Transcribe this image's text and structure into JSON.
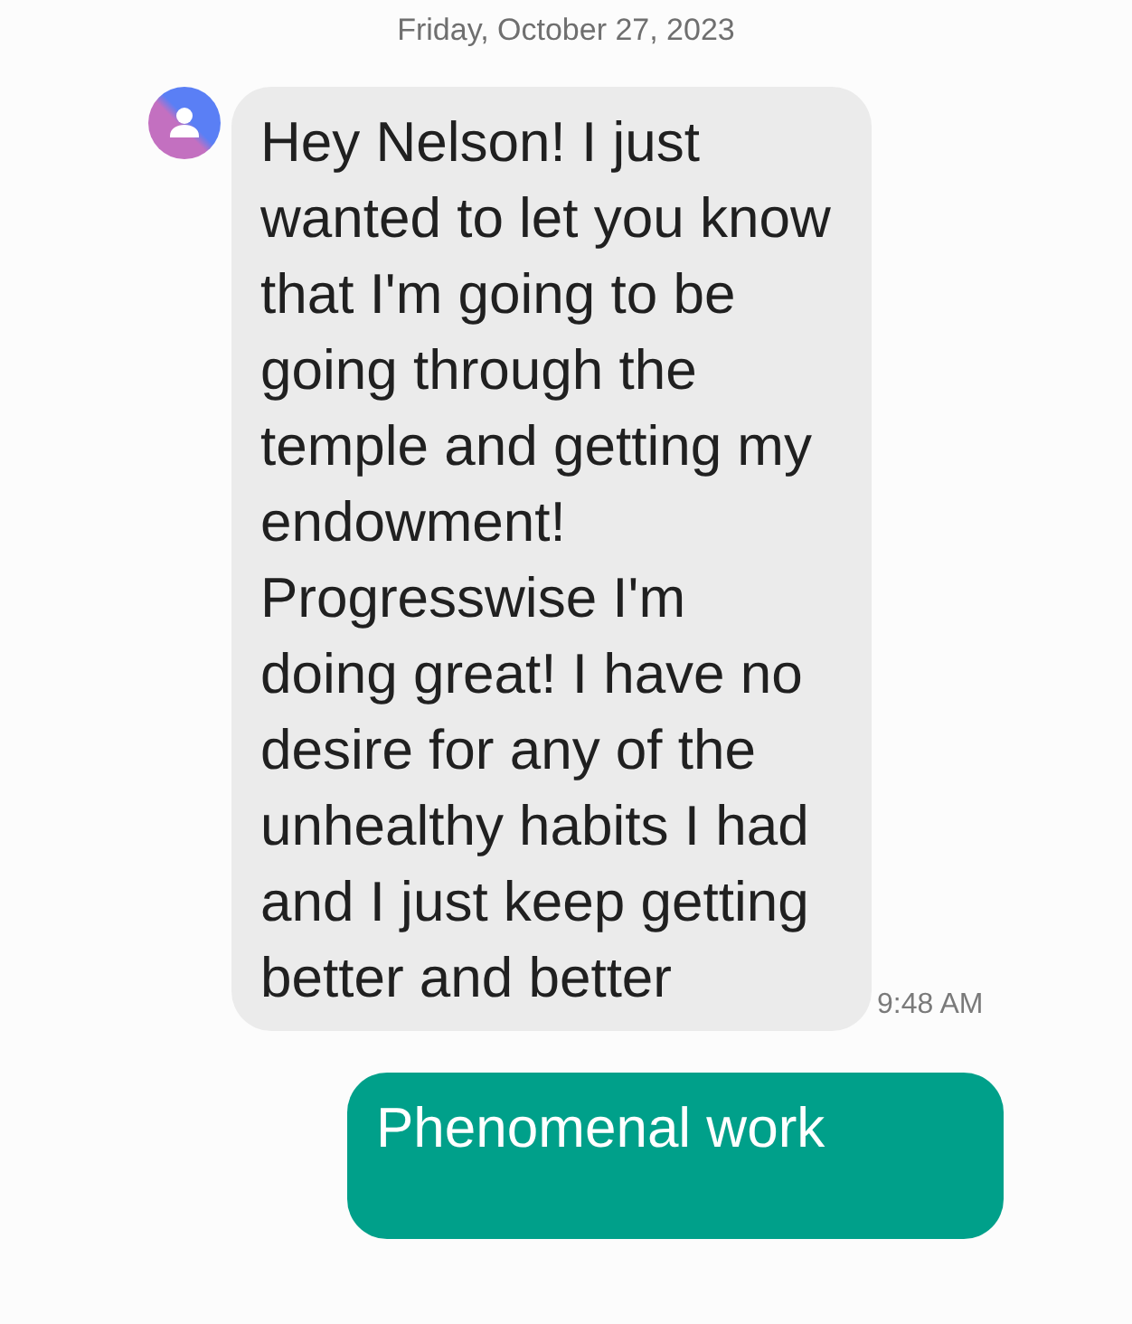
{
  "date_header": "Friday, October 27, 2023",
  "messages": [
    {
      "kind": "incoming",
      "text": "Hey Nelson! I just wanted to let you know that I'm going to be going through the temple and getting my endowment! Progresswise I'm doing great! I have no desire for any of the unhealthy habits I had and I just keep getting better and better",
      "time": "9:48 AM"
    },
    {
      "kind": "outgoing",
      "text": "Phenomenal work"
    }
  ]
}
